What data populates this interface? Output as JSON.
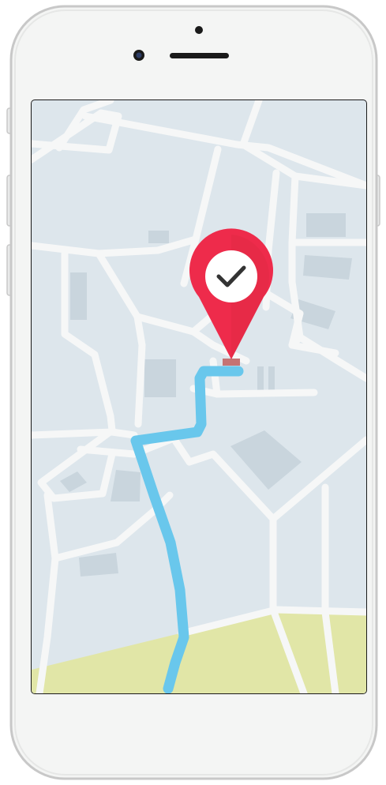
{
  "device": {
    "type": "smartphone",
    "frame_color": "#f4f5f4",
    "frame_border_color": "#c8c8c8",
    "screen_border_color": "#1a1a1a"
  },
  "map": {
    "background_color": "#dde6ec",
    "road_color": "#f6f7f7",
    "block_color": "#c9d5dd",
    "park_color": "#e1e6a7"
  },
  "route": {
    "color": "#69c7ec",
    "destination_reached": true
  },
  "destination_marker": {
    "icon": "map-pin-check-icon",
    "pin_color": "#ee2b4b",
    "check_color": "#333333",
    "base_color": "#c57373"
  }
}
